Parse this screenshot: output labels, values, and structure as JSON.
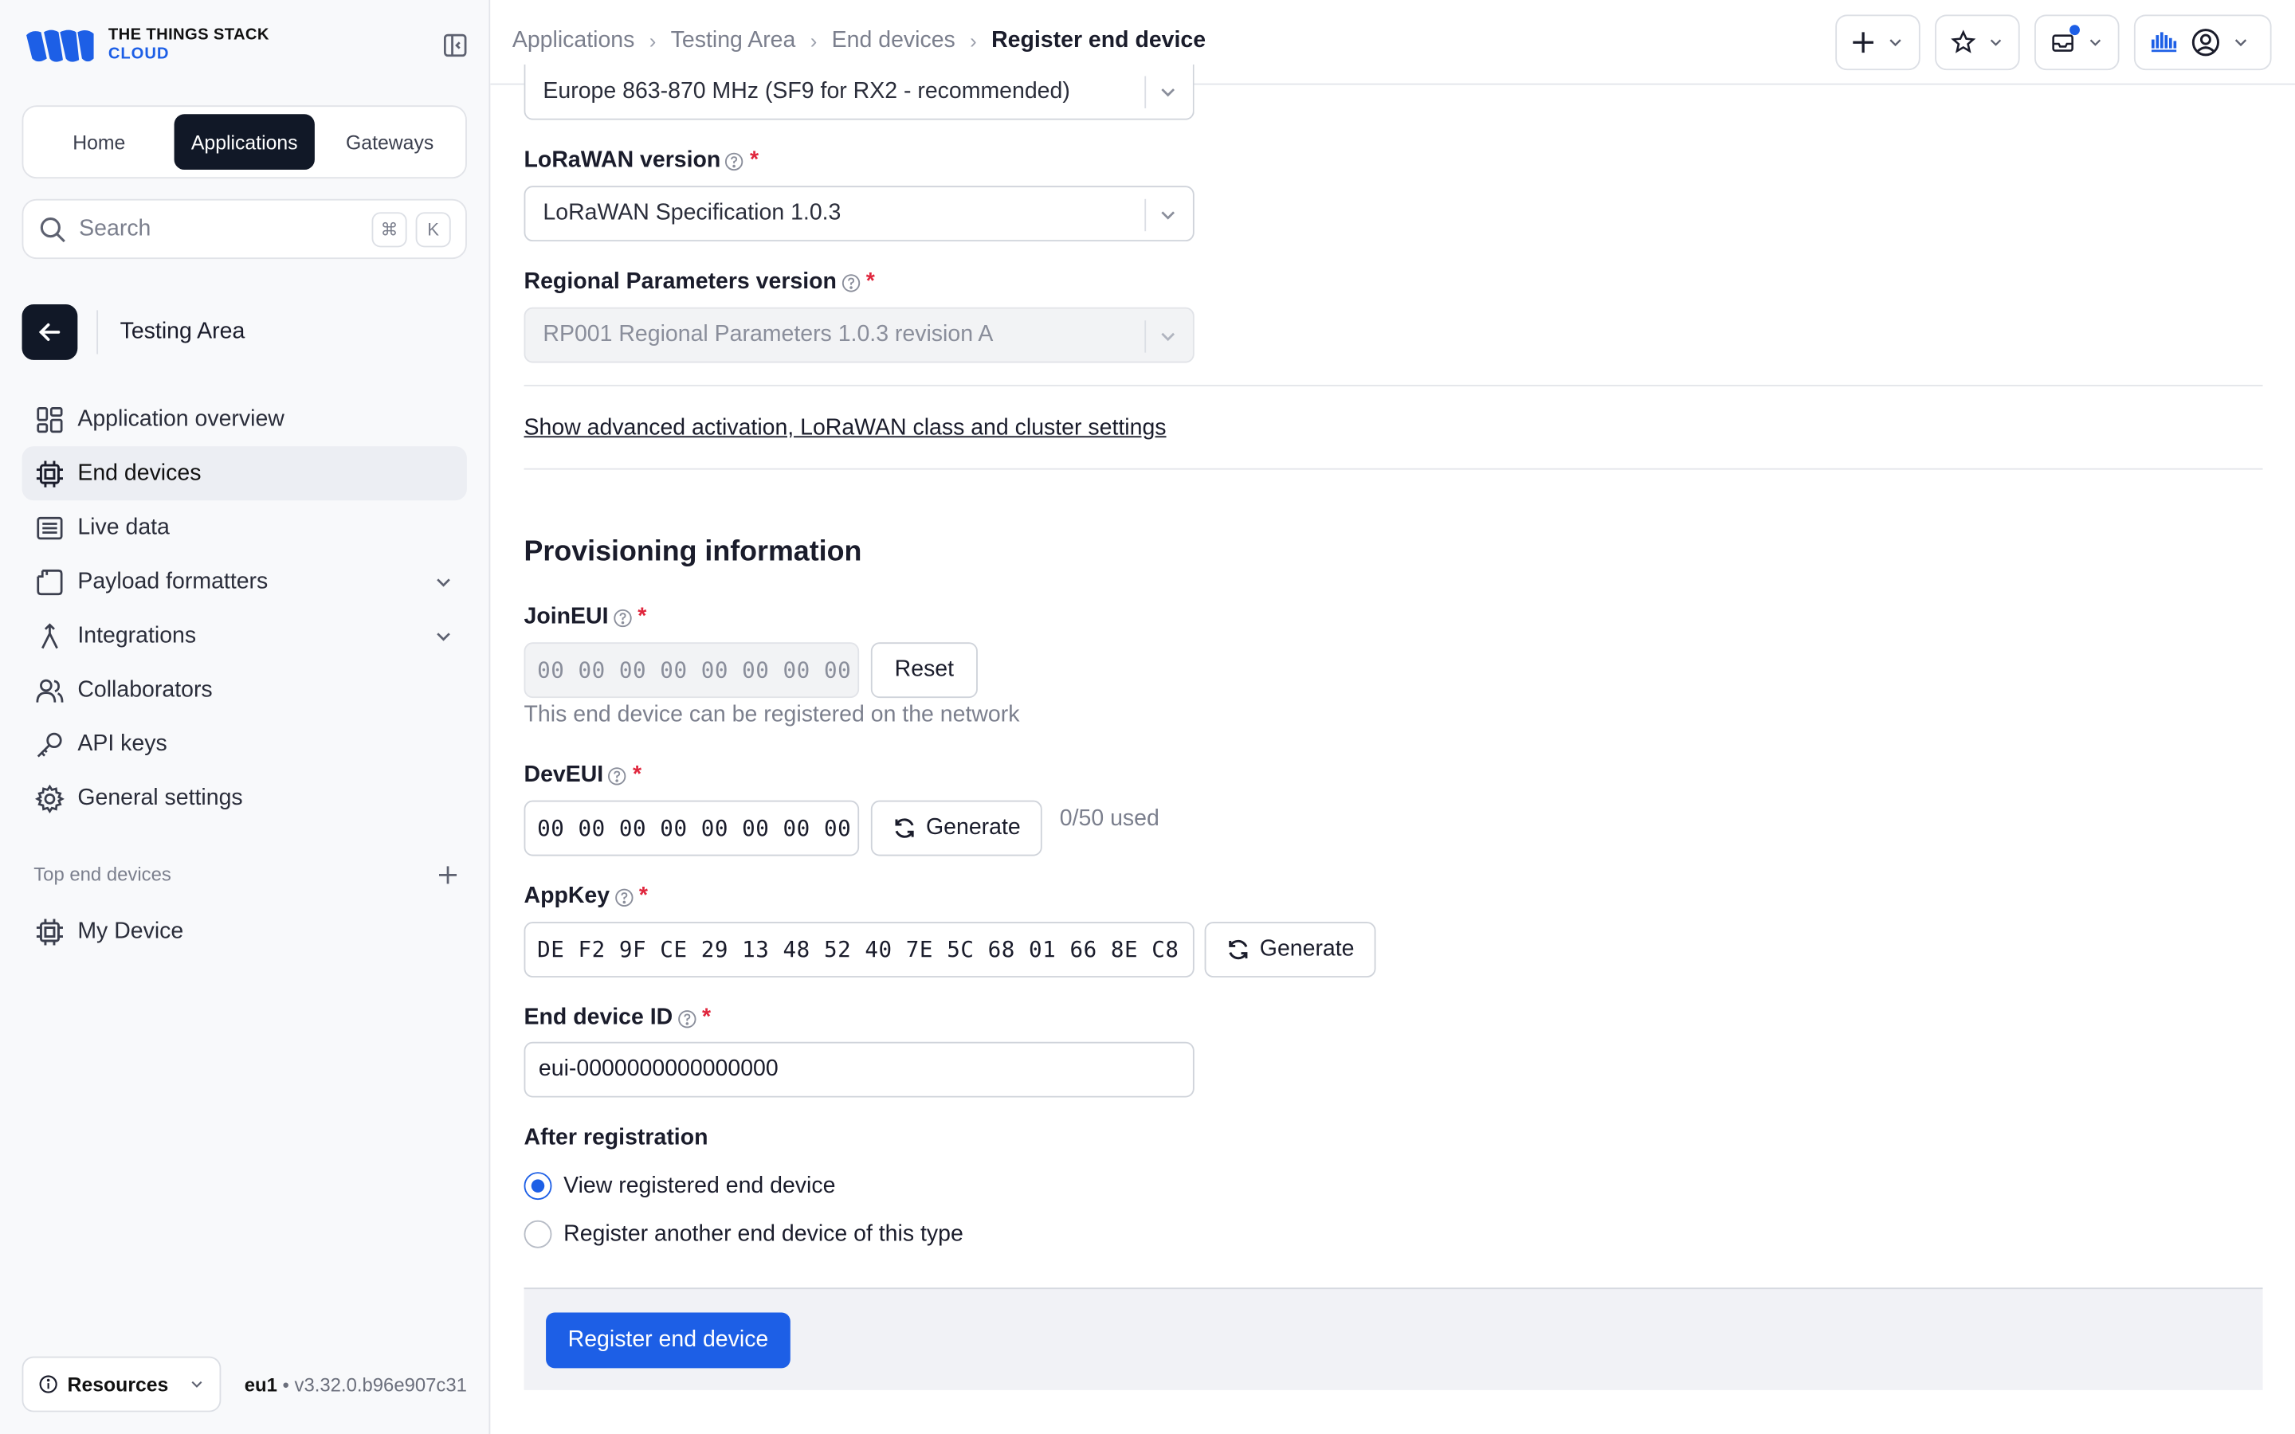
{
  "brand": {
    "line1": "THE THINGS STACK",
    "line2": "CLOUD",
    "accent": "#1d5fe6"
  },
  "tabs": [
    "Home",
    "Applications",
    "Gateways"
  ],
  "search": {
    "placeholder": "Search",
    "key1": "⌘",
    "key2": "K"
  },
  "context": {
    "title": "Testing Area"
  },
  "nav": [
    {
      "label": "Application overview",
      "icon": "dashboard-icon"
    },
    {
      "label": "End devices",
      "icon": "chip-icon"
    },
    {
      "label": "Live data",
      "icon": "list-icon"
    },
    {
      "label": "Payload formatters",
      "icon": "code-icon"
    },
    {
      "label": "Integrations",
      "icon": "integrations-icon"
    },
    {
      "label": "Collaborators",
      "icon": "users-icon"
    },
    {
      "label": "API keys",
      "icon": "key-icon"
    },
    {
      "label": "General settings",
      "icon": "gear-icon"
    }
  ],
  "top_devices": {
    "label": "Top end devices",
    "items": [
      "My Device"
    ]
  },
  "footer": {
    "resources": "Resources",
    "region": "eu1",
    "version": "v3.32.0.b96e907c31"
  },
  "breadcrumbs": [
    "Applications",
    "Testing Area",
    "End devices",
    "Register end device"
  ],
  "form": {
    "frequency_plan": "Europe 863-870 MHz (SF9 for RX2 - recommended)",
    "lorawan_label": "LoRaWAN version",
    "lorawan_value": "LoRaWAN Specification 1.0.3",
    "regional_label": "Regional Parameters version",
    "regional_value": "RP001 Regional Parameters 1.0.3 revision A",
    "advanced_link": "Show advanced activation, LoRaWAN class and cluster settings",
    "provisioning_title": "Provisioning information",
    "joineui_label": "JoinEUI",
    "joineui_value": "00 00 00 00 00 00 00 00",
    "reset_label": "Reset",
    "joineui_hint": "This end device can be registered on the network",
    "deveui_label": "DevEUI",
    "deveui_value": "00 00 00 00 00 00 00 00",
    "generate_label": "Generate",
    "deveui_usage": "0/50 used",
    "appkey_label": "AppKey",
    "appkey_value": "DE F2 9F CE 29 13 48 52 40 7E 5C 68 01 66 8E C8",
    "device_id_label": "End device ID",
    "device_id_value": "eui-0000000000000000",
    "after_label": "After registration",
    "after_options": [
      "View registered end device",
      "Register another end device of this type"
    ],
    "after_selected": 0,
    "submit_label": "Register end device"
  }
}
